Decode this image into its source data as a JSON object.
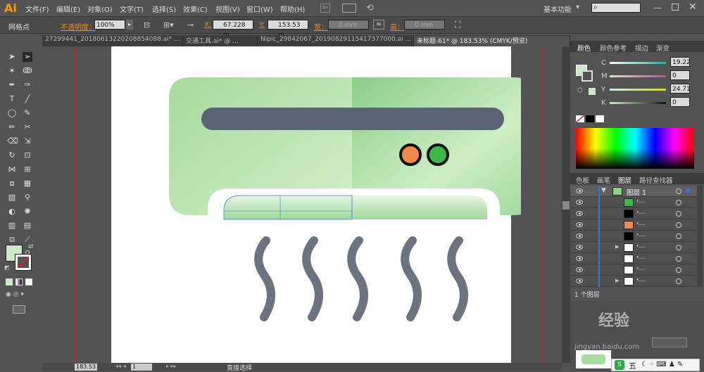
{
  "app": {
    "logo": "Ai"
  },
  "menu": [
    "文件(F)",
    "编辑(E)",
    "对象(O)",
    "文字(T)",
    "选择(S)",
    "效果(C)",
    "视图(V)",
    "窗口(W)",
    "帮助(H)"
  ],
  "workspace": "基本功能",
  "control_bar": {
    "mode_label": "网格点",
    "opacity_label": "不透明度：",
    "opacity_value": "100%",
    "x_label": "X:",
    "x_value": "67.228 m",
    "y_label": "Y:",
    "y_value": "153.53 m",
    "w_label": "宽：",
    "w_value": "0 mm",
    "h_label": "高：",
    "h_value": "0 mm"
  },
  "tabs": [
    {
      "label": "27299441_20180613220208854088.ai* ...",
      "active": false
    },
    {
      "label": "交通工具.ai* @ ...",
      "active": false
    },
    {
      "label": "Nipic_29842067_20190829115417377000.ai ...",
      "active": false
    },
    {
      "label": "未标题-61* @ 183.53% (CMYK/预览)",
      "active": true
    }
  ],
  "color_panel": {
    "tabs": [
      "颜色",
      "颜色参考",
      "描边",
      "渐变"
    ],
    "channels": [
      {
        "name": "C",
        "value": "19.22",
        "color": "#2aa8a0"
      },
      {
        "name": "M",
        "value": "0",
        "color": "#d0409a"
      },
      {
        "name": "Y",
        "value": "24.71",
        "color": "#d6d42a"
      },
      {
        "name": "K",
        "value": "0",
        "color": "#111111"
      }
    ],
    "swatch_color": "#cbebc7"
  },
  "layers_panel": {
    "tabs": [
      "色板",
      "画笔",
      "图层",
      "路径查找器"
    ],
    "layer_name": "图层 1",
    "rows": [
      "‹...",
      "‹...",
      "‹...",
      "‹...",
      "‹...",
      "‹...",
      "‹...",
      "‹..."
    ],
    "footer": "1 个图层"
  },
  "status": {
    "zoom": "183.53",
    "page": "1",
    "tool": "直接选择"
  },
  "watermark": {
    "site": "经验",
    "sub": "jingyan.baidu.com"
  },
  "artboard": {
    "body_left": "#a9dba0",
    "body_right": "#8fd08b",
    "slot": "#5a6472",
    "led1": "#f08a4b",
    "led2": "#3fb84a",
    "wave": "#6b7380"
  },
  "ime": {
    "label": "五"
  }
}
